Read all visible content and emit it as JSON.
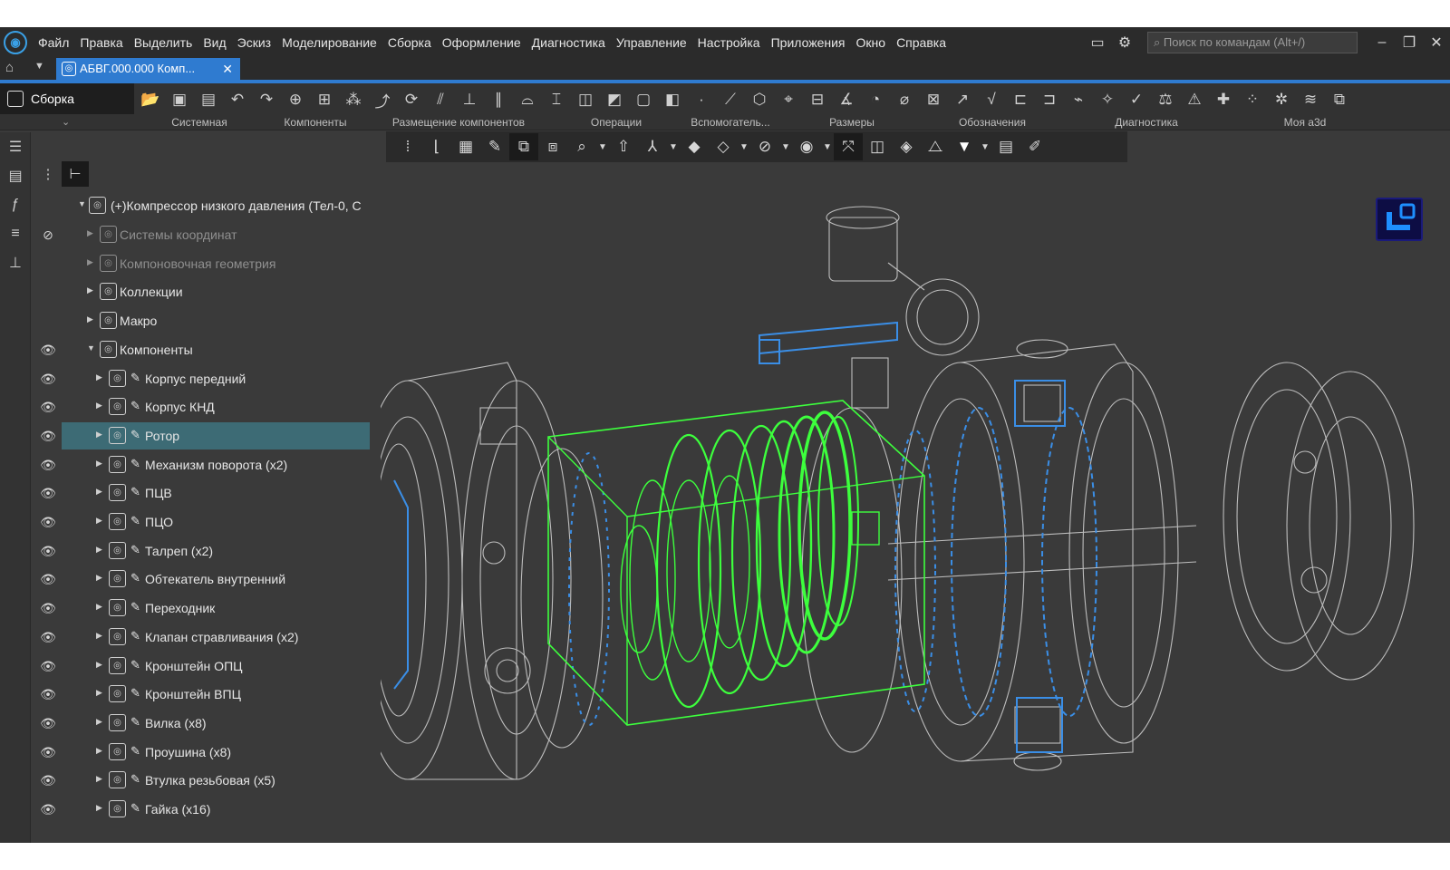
{
  "menubar": {
    "items": [
      "Файл",
      "Правка",
      "Выделить",
      "Вид",
      "Эскиз",
      "Моделирование",
      "Сборка",
      "Оформление",
      "Диагностика",
      "Управление",
      "Настройка",
      "Приложения",
      "Окно",
      "Справка"
    ],
    "search_placeholder": "Поиск по командам (Alt+/)"
  },
  "tabs": [
    {
      "label": "АБВГ.000.000 Комп...",
      "active": true
    }
  ],
  "ribbon": {
    "mode_label": "Сборка",
    "groups": [
      "Системная",
      "Компоненты",
      "Размещение компонентов",
      "Операции",
      "Вспомогатель...",
      "Размеры",
      "Обозначения",
      "Диагностика",
      "Моя а3d"
    ]
  },
  "tree": {
    "root": "(+)Компрессор низкого давления (Тел-0, С",
    "rows": [
      {
        "label": "Системы координат",
        "dim": true
      },
      {
        "label": "Компоновочная геометрия",
        "dim": true
      },
      {
        "label": "Коллекции",
        "dim": false
      },
      {
        "label": "Макро",
        "dim": false
      },
      {
        "label": "Компоненты",
        "dim": false
      },
      {
        "label": "Корпус передний"
      },
      {
        "label": "Корпус КНД"
      },
      {
        "label": "Ротор",
        "selected": true
      },
      {
        "label": "Механизм поворота (x2)"
      },
      {
        "label": "ПЦВ"
      },
      {
        "label": "ПЦО"
      },
      {
        "label": "Талреп (x2)"
      },
      {
        "label": "Обтекатель внутренний"
      },
      {
        "label": "Переходник"
      },
      {
        "label": "Клапан стравливания (x2)"
      },
      {
        "label": "Кронштейн ОПЦ"
      },
      {
        "label": "Кронштейн ВПЦ"
      },
      {
        "label": "Вилка (x8)"
      },
      {
        "label": "Проушина (x8)"
      },
      {
        "label": "Втулка резьбовая (x5)"
      },
      {
        "label": "Гайка (x16)"
      }
    ]
  },
  "colors": {
    "accent": "#2f7bd0",
    "selection": "#3d6b75",
    "highlight_green": "#3dff3d",
    "wire": "#c8c8c8",
    "wire_blue": "#3a8ee6"
  }
}
